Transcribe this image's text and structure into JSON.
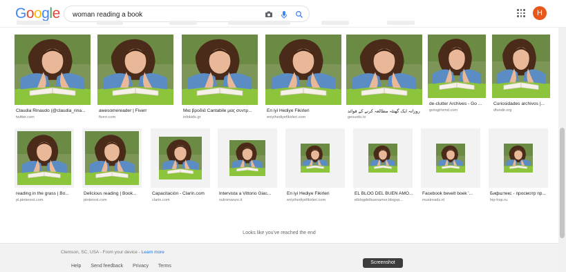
{
  "search": {
    "query": "woman reading a book"
  },
  "user": {
    "initial": "H"
  },
  "results": [
    {
      "caption": "Claudia Rinaudo (@claudia_rina...",
      "source": "twitter.com"
    },
    {
      "caption": "awesomereader | Fiverr",
      "source": "fiverr.com"
    },
    {
      "caption": "Μια βροδιά Cantabile μας συντρ...",
      "source": "infokids.gr"
    },
    {
      "caption": "En iyi Hediye Fikirleri",
      "source": "eniyihediyefikirleri.com"
    },
    {
      "caption": "روزانہ ایک گھنٹہ مطالعہ کرنے کے فوائد",
      "source": "geourdu.tv"
    },
    {
      "caption": "de-clutter Archives - Go ...",
      "source": "gotogirlsmd.com"
    },
    {
      "caption": "Curiosidades archivos |...",
      "source": "dfundir.org"
    },
    {
      "caption": "reading in the grass | Bo...",
      "source": "pl.pinterest.com"
    },
    {
      "caption": "Delicious reading | Book...",
      "source": "pinterest.com"
    },
    {
      "caption": "Capacitación - Clarín.com",
      "source": "clarin.com"
    },
    {
      "caption": "Intervista a Vittorio Giac...",
      "source": "sulromanzo.it"
    },
    {
      "caption": "En iyi Hediye Fikirleri",
      "source": "eniyihediyefikirleri.com"
    },
    {
      "caption": "EL BLOG DEL BUEN AMO...",
      "source": "elblogdelbuenamor.blogsp..."
    },
    {
      "caption": "Facebook bevelt boek '...",
      "source": "mustreads.nl"
    },
    {
      "caption": "Бифштекс - просмотр пр...",
      "source": "hip-hop.ru"
    }
  ],
  "end_message": "Looks like you've reached the end",
  "footer": {
    "location": "Clemson, SC, USA - From your device - ",
    "learn_more": "Learn more",
    "links": [
      "Help",
      "Send feedback",
      "Privacy",
      "Terms"
    ]
  },
  "tooltip": "Screenshot",
  "colors": {
    "accent": "#1a73e8",
    "avatar": "#e8581c"
  }
}
